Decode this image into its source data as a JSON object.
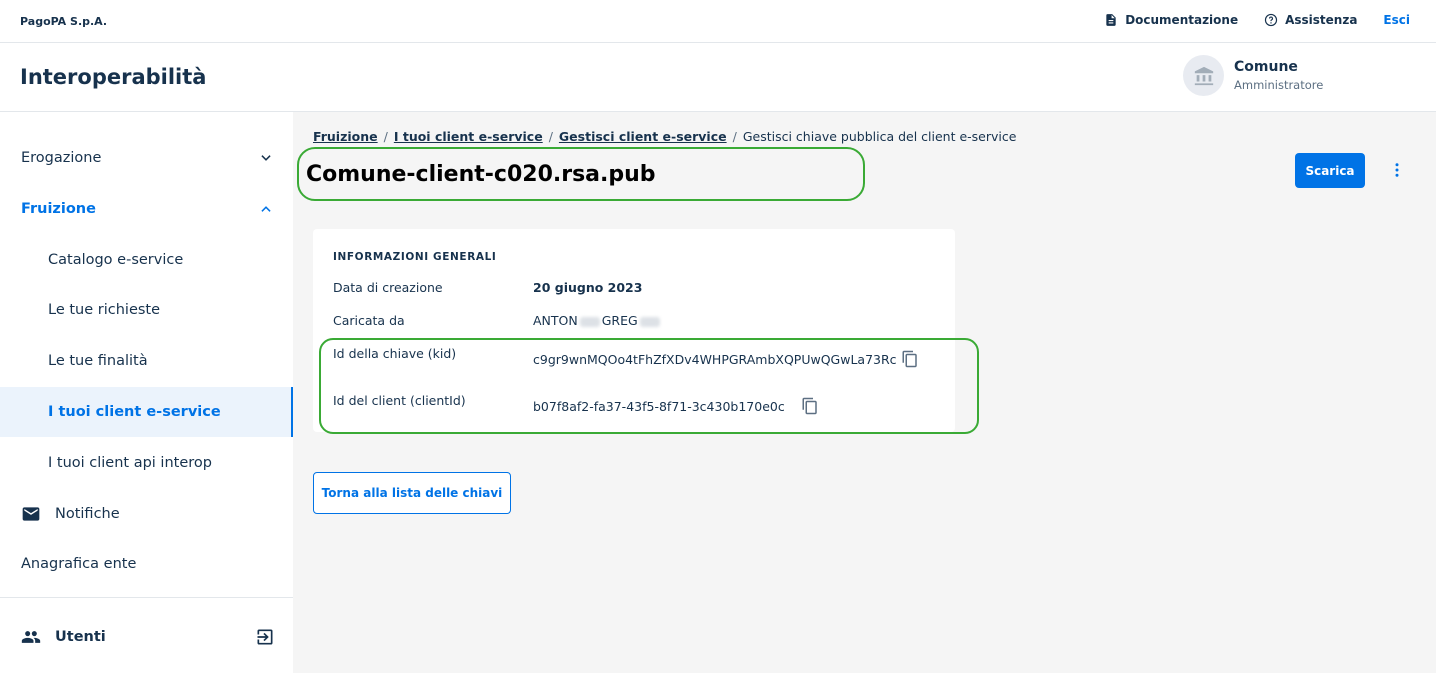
{
  "topbar": {
    "brand": "PagoPA S.p.A.",
    "docs_label": "Documentazione",
    "help_label": "Assistenza",
    "logout_label": "Esci"
  },
  "header": {
    "product": "Interoperabilità",
    "party_name": "Comune",
    "party_role": "Amministratore"
  },
  "sidebar": {
    "items": [
      {
        "label": "Erogazione"
      },
      {
        "label": "Fruizione"
      },
      {
        "label": "Catalogo e-service"
      },
      {
        "label": "Le tue richieste"
      },
      {
        "label": "Le tue finalità"
      },
      {
        "label": "I tuoi client e-service"
      },
      {
        "label": "I tuoi client api interop"
      },
      {
        "label": "Notifiche"
      },
      {
        "label": "Anagrafica ente"
      }
    ],
    "users_label": "Utenti"
  },
  "breadcrumb": {
    "items": [
      "Fruizione",
      "I tuoi client e-service",
      "Gestisci client e-service"
    ],
    "current": "Gestisci chiave pubblica del client e-service",
    "separator": "/"
  },
  "page": {
    "title": "Comune-client-c020.rsa.pub",
    "download_label": "Scarica"
  },
  "info": {
    "section_title": "INFORMAZIONI GENERALI",
    "created_label": "Data di creazione",
    "created_value": "20 giugno 2023",
    "uploaded_by_label": "Caricata da",
    "uploaded_by_first": "ANTON",
    "uploaded_by_last": "GREG",
    "kid_label": "Id della chiave (kid)",
    "kid_value": "c9gr9wnMQOo4tFhZfXDv4WHPGRAmbXQPUwQGwLa73Rc",
    "client_id_label": "Id del client (clientId)",
    "client_id_value": "b07f8af2-fa37-43f5-8f71-3c430b170e0c"
  },
  "back_button_label": "Torna alla lista delle chiavi",
  "colors": {
    "primary": "#0073E6",
    "highlight": "#3AAA35",
    "text": "#17324D",
    "background": "#F5F5F5"
  }
}
